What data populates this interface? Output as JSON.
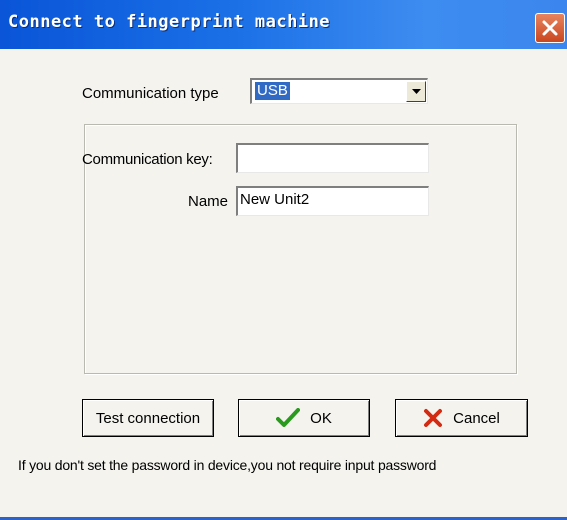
{
  "window": {
    "title": "Connect to fingerprint machine"
  },
  "communication_type": {
    "label": "Communication type",
    "selected": "USB"
  },
  "group": {
    "key_label": "Communication key:",
    "key_value": "",
    "name_label": "Name",
    "name_value": "New Unit2"
  },
  "buttons": {
    "test": "Test connection",
    "ok": "OK",
    "cancel": "Cancel"
  },
  "hint": "If you don't set the password in device,you not require input password",
  "colors": {
    "titlebar": "#0a55d8",
    "selection": "#316ac5",
    "ok_check": "#2a9a1e",
    "cancel_x": "#d42a12"
  },
  "icons": {
    "close": "close-icon",
    "dropdown": "chevron-down-icon",
    "ok": "checkmark-icon",
    "cancel": "x-icon"
  }
}
